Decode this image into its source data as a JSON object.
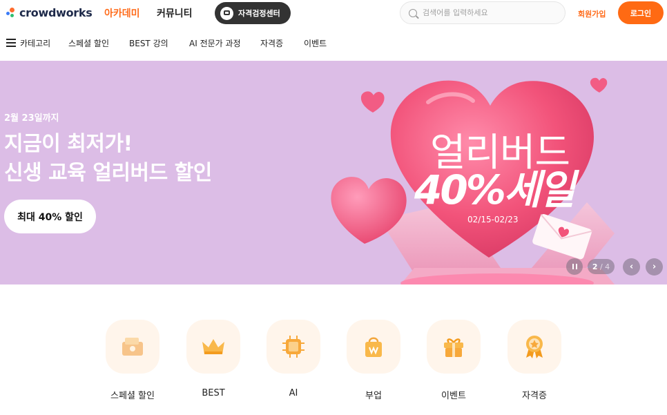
{
  "header": {
    "logo_text": "crowdworks",
    "nav": [
      "아카데미",
      "커뮤니티"
    ],
    "cert_button": "자격검정센터",
    "search_placeholder": "검색어를 입력하세요",
    "signup": "회원가입",
    "login": "로그인"
  },
  "subnav": {
    "category": "카테고리",
    "items": [
      "스페셜 할인",
      "BEST 강의",
      "AI 전문가 과정",
      "자격증",
      "이벤트"
    ]
  },
  "hero": {
    "date": "2월 23일까지",
    "title_line1": "지금이 최저가!",
    "title_line2": "신생 교육 얼리버드 할인",
    "cta": "최대 40% 할인",
    "art_line1": "얼리버드",
    "art_line2": "40%세일",
    "art_dates": "02/15-02/23",
    "pager_current": "2",
    "pager_total": "4"
  },
  "categories": [
    {
      "label": "스페셜 할인",
      "icon": "gift-card-icon"
    },
    {
      "label": "BEST",
      "icon": "crown-icon"
    },
    {
      "label": "AI",
      "icon": "ai-chip-icon"
    },
    {
      "label": "부업",
      "icon": "shopping-bag-won-icon"
    },
    {
      "label": "이벤트",
      "icon": "gift-box-icon"
    },
    {
      "label": "자격증",
      "icon": "medal-icon"
    }
  ],
  "colors": {
    "brand_orange": "#ff6a13",
    "hero_bg": "#dcbde6",
    "heart_pink": "#f2537a",
    "tile_bg": "#fff5eb"
  }
}
